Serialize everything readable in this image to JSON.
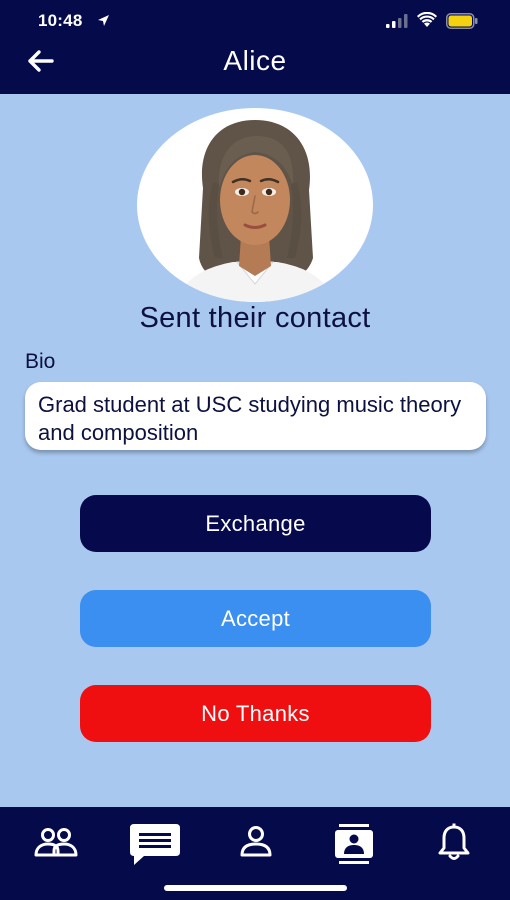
{
  "status_bar": {
    "time": "10:48"
  },
  "header": {
    "title": "Alice"
  },
  "profile": {
    "subtitle": "Sent their contact",
    "bio_label": "Bio",
    "bio_text": "Grad student at USC studying music theory and composition"
  },
  "actions": {
    "exchange_label": "Exchange",
    "accept_label": "Accept",
    "decline_label": "No Thanks"
  },
  "tab_bar": {
    "items": [
      {
        "icon": "people-icon"
      },
      {
        "icon": "chat-icon"
      },
      {
        "icon": "person-icon"
      },
      {
        "icon": "contact-card-icon"
      },
      {
        "icon": "bell-icon"
      }
    ]
  },
  "colors": {
    "header_bg": "#050a4a",
    "page_bg": "#a9c8f0",
    "exchange_bg": "#060a4c",
    "accept_bg": "#3b8ff0",
    "decline_bg": "#ef0f10"
  }
}
